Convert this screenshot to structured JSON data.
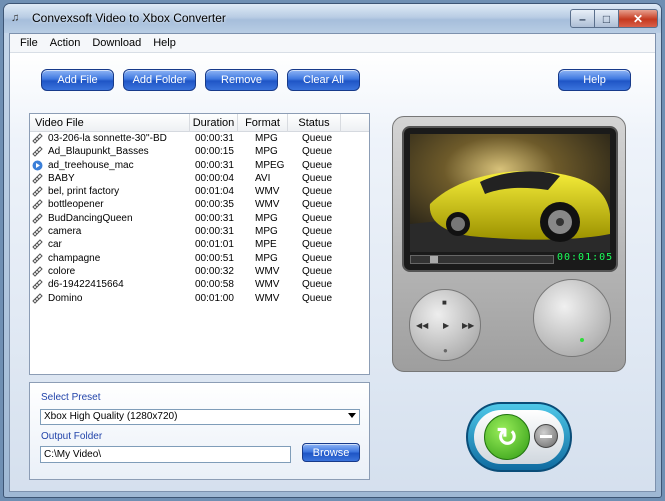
{
  "window": {
    "title": "Convexsoft Video to Xbox Converter"
  },
  "menu": [
    "File",
    "Action",
    "Download",
    "Help"
  ],
  "toolbar": {
    "add_file": "Add File",
    "add_folder": "Add Folder",
    "remove": "Remove",
    "clear_all": "Clear All",
    "help": "Help"
  },
  "table": {
    "columns": [
      "Video File",
      "Duration",
      "Format",
      "Status"
    ],
    "rows": [
      [
        "03-206-la sonnette-30''-BD",
        "00:00:31",
        "MPG",
        "Queue"
      ],
      [
        "Ad_Blaupunkt_Basses",
        "00:00:15",
        "MPG",
        "Queue"
      ],
      [
        "ad_treehouse_mac",
        "00:00:31",
        "MPEG",
        "Queue"
      ],
      [
        "BABY",
        "00:00:04",
        "AVI",
        "Queue"
      ],
      [
        "bel, print factory",
        "00:01:04",
        "WMV",
        "Queue"
      ],
      [
        "bottleopener",
        "00:00:35",
        "WMV",
        "Queue"
      ],
      [
        "BudDancingQueen",
        "00:00:31",
        "MPG",
        "Queue"
      ],
      [
        "camera",
        "00:00:31",
        "MPG",
        "Queue"
      ],
      [
        "car",
        "00:01:01",
        "MPE",
        "Queue"
      ],
      [
        "champagne",
        "00:00:51",
        "MPG",
        "Queue"
      ],
      [
        "colore",
        "00:00:32",
        "WMV",
        "Queue"
      ],
      [
        "d6-19422415664",
        "00:00:58",
        "WMV",
        "Queue"
      ],
      [
        "Domino",
        "00:01:00",
        "WMV",
        "Queue"
      ]
    ]
  },
  "preset": {
    "label": "Select Preset",
    "value": "Xbox High Quality (1280x720)",
    "folder_label": "Output Folder",
    "folder_value": "C:\\My Video\\",
    "browse": "Browse"
  },
  "player": {
    "timecode": "00:01:05",
    "progress": 0.14
  }
}
